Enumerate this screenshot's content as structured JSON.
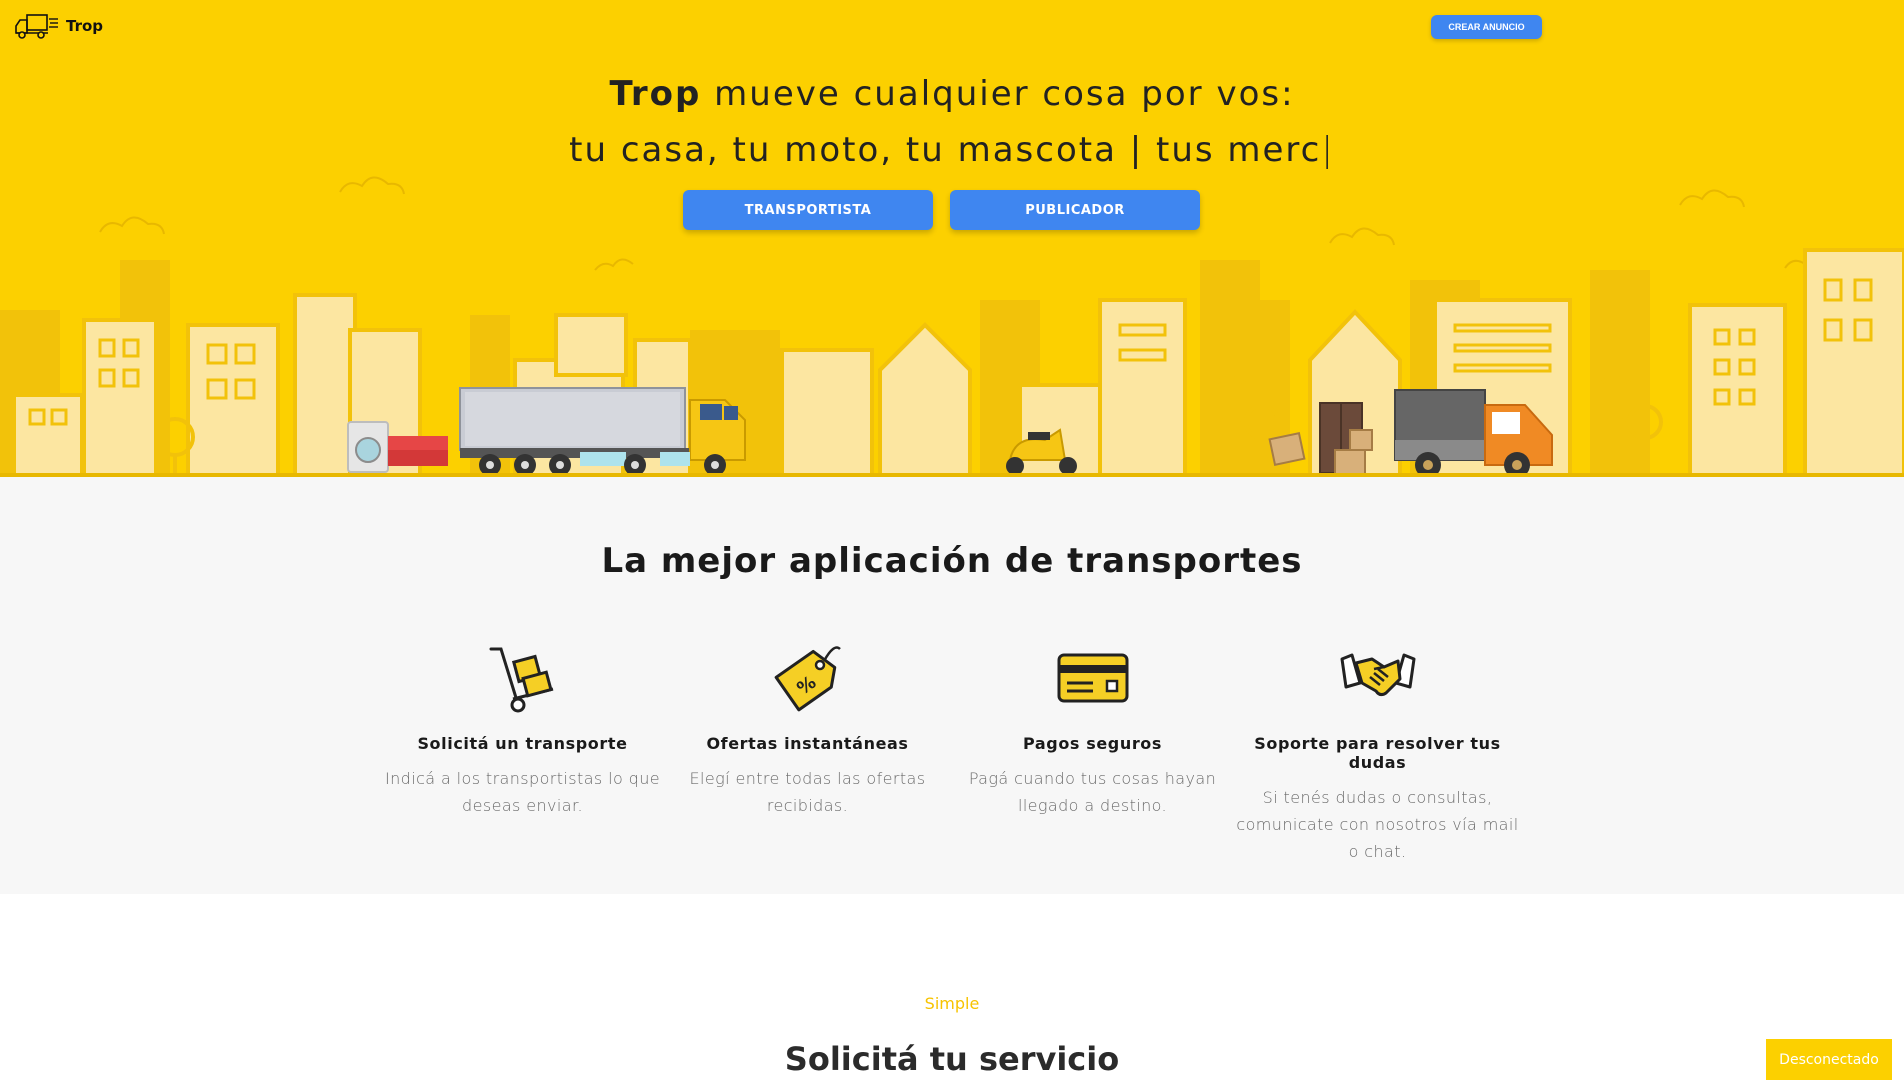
{
  "header": {
    "brand": "Trop",
    "logo_icon": "truck-icon",
    "cta_label": "CREAR ANUNCIO"
  },
  "hero": {
    "brand_word": "Trop",
    "line1_rest": " mueve cualquier cosa por vos:",
    "line2": "tu casa, tu moto, tu mascota | tus merc",
    "cursor": "|",
    "buttons": [
      "TRANSPORTISTA",
      "PUBLICADOR"
    ],
    "illustration": "city-skyline-with-vehicles"
  },
  "features": {
    "title": "La mejor aplicación de transportes",
    "items": [
      {
        "icon": "hand-truck-icon",
        "title": "Solicitá un transporte",
        "text": "Indicá a los transportistas lo que deseas enviar."
      },
      {
        "icon": "price-tag-icon",
        "title": "Ofertas instantáneas",
        "text": "Elegí entre todas las ofertas recibidas."
      },
      {
        "icon": "credit-card-icon",
        "title": "Pagos seguros",
        "text": "Pagá cuando tus cosas hayan llegado a destino."
      },
      {
        "icon": "handshake-icon",
        "title": "Soporte para resolver tus dudas",
        "text": "Si tenés dudas o consultas, comunicate con nosotros vía mail o chat."
      }
    ]
  },
  "service": {
    "eyebrow": "Simple",
    "title": "Solicitá tu servicio"
  },
  "status": {
    "label": "Desconectado"
  },
  "colors": {
    "hero_bg": "#FCD000",
    "button_blue": "#3F86F0",
    "features_bg": "#F7F7F7",
    "accent_yellow": "#F7C300"
  }
}
